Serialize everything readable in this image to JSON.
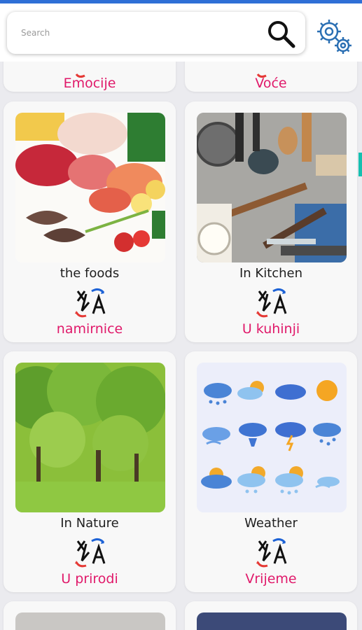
{
  "search": {
    "placeholder": "Search"
  },
  "categories_partial_top": [
    {
      "hr": "Emocije"
    },
    {
      "hr": "Voće"
    }
  ],
  "categories": [
    {
      "en": "the foods",
      "hr": "namirnice",
      "image": "food-photo"
    },
    {
      "en": "In Kitchen",
      "hr": "U kuhinji",
      "image": "kitchen-utensils-photo"
    },
    {
      "en": "In Nature",
      "hr": "U prirodi",
      "image": "forest-park-photo"
    },
    {
      "en": "Weather",
      "hr": "Vrijeme",
      "image": "weather-icons-illustration"
    }
  ],
  "colors": {
    "accent": "#e0196a",
    "logo_red": "#e53935",
    "logo_blue": "#1e63d6",
    "scroll_indicator": "#16c0b0"
  }
}
